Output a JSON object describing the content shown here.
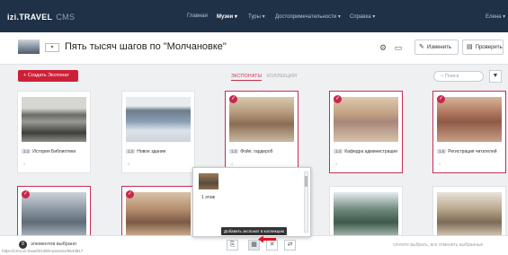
{
  "topbar": {
    "brand": "izi.TRAVEL",
    "brand_suffix": "CMS",
    "nav": [
      "Главная",
      "Музеи ▾",
      "Туры ▾",
      "Достопримечательности ▾",
      "Справка ▾"
    ],
    "user": "Елена ▾"
  },
  "header": {
    "title": "Пять тысяч шагов по \"Молчановке\"",
    "edit_label": "Изменить",
    "preview_label": "Проверить"
  },
  "toolbar": {
    "add_exhibit_label": "+ Создать Экспонат",
    "tabs": [
      "ЭКСПОНАТЫ",
      "КОЛЛЕКЦИИ"
    ],
    "search_placeholder": "Поиск"
  },
  "cards": [
    {
      "num": "1.1",
      "caption": "История Библиотеки",
      "selected": false
    },
    {
      "num": "1.2",
      "caption": "Новое здание",
      "selected": false
    },
    {
      "num": "1.3",
      "caption": "Фойе, гардероб",
      "selected": true
    },
    {
      "num": "1.4",
      "caption": "Кафедра администрации",
      "selected": true
    },
    {
      "num": "1.5",
      "caption": "Регистрация читателей",
      "selected": true
    }
  ],
  "popup": {
    "item_label": "1 этаж",
    "tooltip": "Добавить экспонат в коллекцию"
  },
  "bottombar": {
    "selected_count": "8",
    "selected_text": "элементов выбрано",
    "url": "https://cms.izi.travel/2139/museums/6543817",
    "hint": "сочтите выбрать, все отменить выбранные"
  },
  "colors": {
    "topbar": "#1f3147",
    "accent": "#cc2036",
    "selected_border": "#c92d55"
  }
}
